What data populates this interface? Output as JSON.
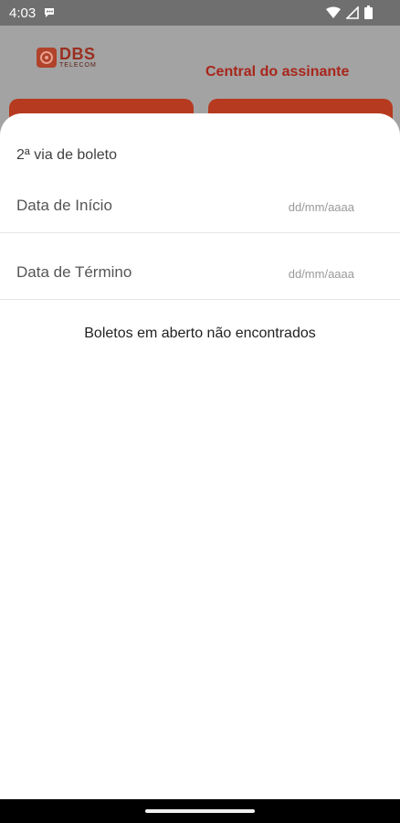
{
  "status_bar": {
    "time": "4:03",
    "icons": [
      "message-icon",
      "wifi-icon",
      "signal-icon",
      "battery-icon"
    ]
  },
  "header": {
    "logo_name": "DBS",
    "logo_sub": "TELECOM",
    "title": "Central do assinante"
  },
  "sheet": {
    "title": "2ª via de boleto",
    "start_label": "Data de Início",
    "start_placeholder": "dd/mm/aaaa",
    "start_value": "",
    "end_label": "Data de Término",
    "end_placeholder": "dd/mm/aaaa",
    "end_value": "",
    "empty_message": "Boletos em aberto não encontrados"
  },
  "colors": {
    "brand": "#b63a1f",
    "title_red": "#a8261b",
    "scrim": "#a3a3a3"
  }
}
